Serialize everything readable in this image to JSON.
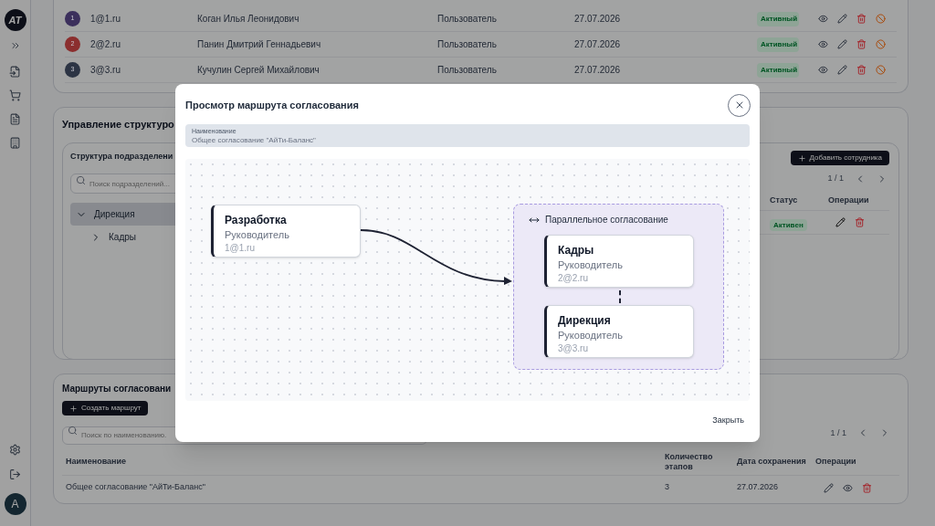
{
  "sidebar": {
    "logo": "AT",
    "avatar": "A"
  },
  "users": {
    "rows": [
      {
        "number": "1",
        "color": "#3b2f5c",
        "email": "1@1.ru",
        "name": "Коган Илья Леонидович",
        "role": "Пользователь",
        "date": "27.07.2026",
        "status": "Активный"
      },
      {
        "number": "2",
        "color": "#8b2e2e",
        "email": "2@2.ru",
        "name": "Панин Дмитрий Геннадьевич",
        "role": "Пользователь",
        "date": "27.07.2026",
        "status": "Активный"
      },
      {
        "number": "3",
        "color": "#2c3444",
        "email": "3@3.ru",
        "name": "Кучулин Сергей Михайлович",
        "role": "Пользователь",
        "date": "27.07.2026",
        "status": "Активный"
      }
    ]
  },
  "structure": {
    "title": "Управление структуро",
    "tree_title": "Структура подразделени",
    "search": {
      "placeholder": "Поиск подразделений..."
    },
    "tree": [
      {
        "label": "Дирекция",
        "expanded": true,
        "selected": true,
        "children": [
          {
            "label": "Кадры",
            "expanded": false,
            "selected": false
          }
        ]
      }
    ],
    "add_button": "Добавить сотрудника",
    "pagination": "1 / 1",
    "columns": [
      "Статус",
      "Операции"
    ],
    "rows": [
      {
        "status": "Активен"
      }
    ]
  },
  "routes": {
    "title": "Маршруты согласовани",
    "create_button": "Создать маршрут",
    "search": {
      "placeholder": "Поиск по наименованию."
    },
    "pagination": "1 / 1",
    "columns": [
      "Наименование",
      "Количество этапов",
      "Дата сохранения",
      "Операции"
    ],
    "rows": [
      {
        "name": "Общее согласование \"АйТи-Баланс\"",
        "stages": "3",
        "date": "27.07.2026"
      }
    ]
  },
  "modal": {
    "title": "Просмотр маршрута согласования",
    "field": {
      "label": "Наименование",
      "value": "Общее согласование \"АйТи-Баланс\""
    },
    "steps": [
      {
        "kind": "single",
        "title": "Разработка",
        "role": "Руководитель",
        "email": "1@1.ru"
      },
      {
        "kind": "parallel",
        "label": "Параллельное согласование",
        "members": [
          {
            "title": "Кадры",
            "role": "Руководитель",
            "email": "2@2.ru"
          },
          {
            "title": "Дирекция",
            "role": "Руководитель",
            "email": "3@3.ru"
          }
        ]
      }
    ],
    "close_button": "Закрыть"
  }
}
